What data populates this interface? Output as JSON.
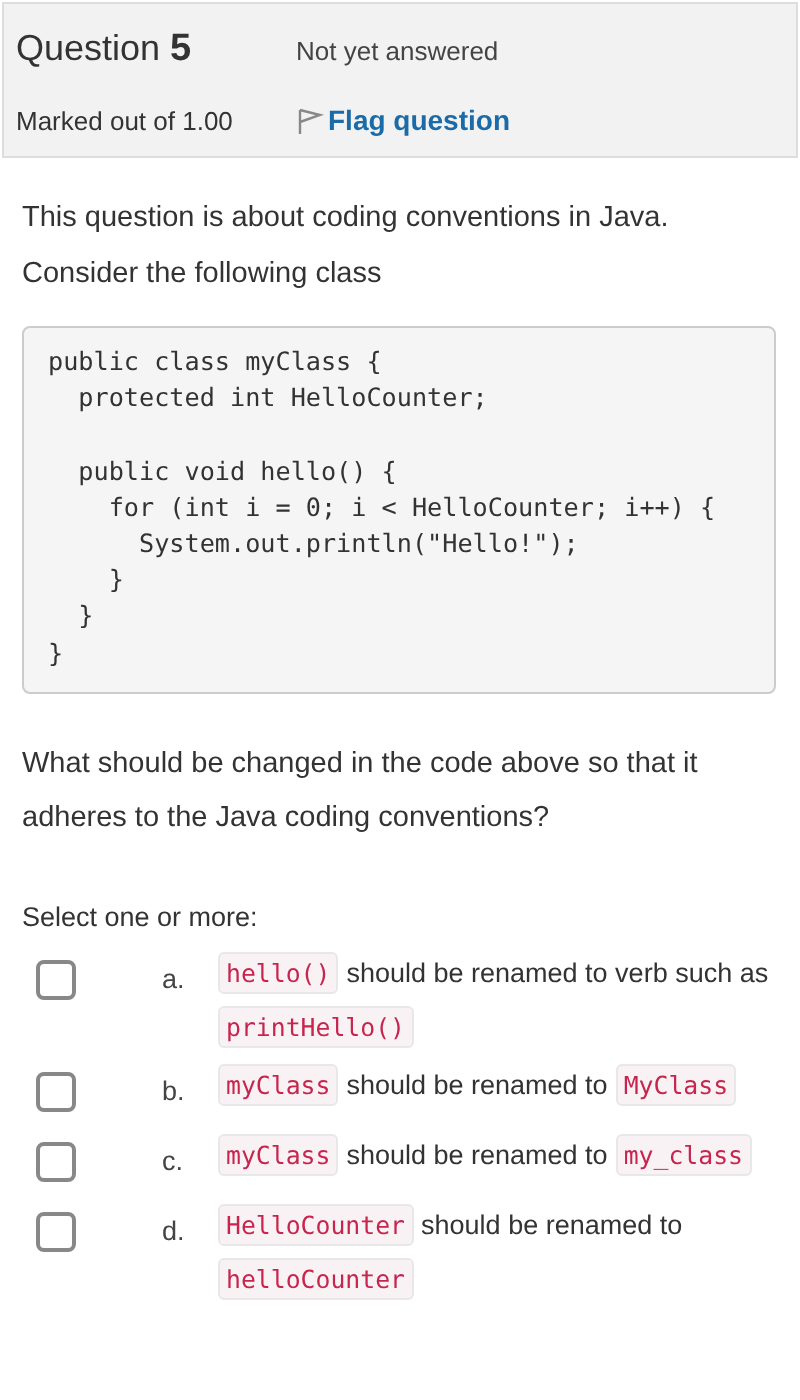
{
  "header": {
    "title": "Question",
    "number": "5",
    "status": "Not yet answered",
    "marks": "Marked out of 1.00",
    "flag": {
      "label": "Flag question",
      "flagged": false
    }
  },
  "question": {
    "intro": [
      "This question is about coding conventions in Java.",
      "Consider the following class"
    ],
    "code_blocks": [
      [
        "public class myClass {",
        "  protected int HelloCounter;"
      ],
      [
        "  public void hello() {",
        "    for (int i = 0; i < HelloCounter; i++) {",
        "      System.out.println(\"Hello!\");",
        "    }",
        "  }",
        "}"
      ]
    ],
    "prompt": "What should be changed in the code above so that it adheres to the Java coding conventions?"
  },
  "answer": {
    "instruction": "Select one or more:",
    "options": [
      {
        "letter": "a.",
        "checked": false,
        "parts": [
          {
            "kind": "code",
            "text": "hello()"
          },
          {
            "kind": "text",
            "text": "should be renamed to verb such as"
          },
          {
            "kind": "code",
            "text": "printHello()"
          }
        ]
      },
      {
        "letter": "b.",
        "checked": false,
        "parts": [
          {
            "kind": "code",
            "text": "myClass"
          },
          {
            "kind": "text",
            "text": "should be renamed to"
          },
          {
            "kind": "code",
            "text": "MyClass"
          }
        ]
      },
      {
        "letter": "c.",
        "checked": false,
        "parts": [
          {
            "kind": "code",
            "text": "myClass"
          },
          {
            "kind": "text",
            "text": "should be renamed to"
          },
          {
            "kind": "code",
            "text": "my_class"
          }
        ]
      },
      {
        "letter": "d.",
        "checked": false,
        "parts": [
          {
            "kind": "code",
            "text": "HelloCounter"
          },
          {
            "kind": "text",
            "text": "should be renamed to"
          },
          {
            "kind": "code",
            "text": "helloCounter"
          }
        ]
      }
    ]
  }
}
